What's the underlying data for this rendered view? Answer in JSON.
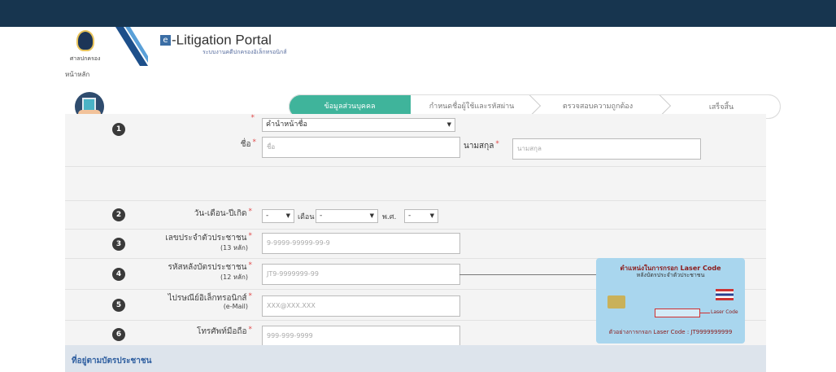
{
  "header": {
    "logo_text": "ศาลปกครอง",
    "title": "-Litigation Portal",
    "title_prefix": "e",
    "subtitle": "ระบบงานคดีปกครองอิเล็กทรอนิกส์"
  },
  "breadcrumb": "หน้าหลัก",
  "steps": [
    {
      "label": "ข้อมูลส่วนบุคคล",
      "active": true
    },
    {
      "label": "กำหนดชื่อผู้ใช้และรหัสผ่าน",
      "active": false
    },
    {
      "label": "ตรวจสอบความถูกต้อง",
      "active": false
    },
    {
      "label": "เสร็จสิ้น",
      "active": false
    }
  ],
  "form": {
    "row1": {
      "number": "1",
      "name_label": "ชื่อ",
      "title_select": "คำนำหน้าชื่อ",
      "firstname_placeholder": "ชื่อ",
      "lastname_label": "นามสกุล",
      "lastname_placeholder": "นามสกุล"
    },
    "row2": {
      "number": "2",
      "label": "วัน-เดือน-ปีเกิด",
      "day_value": "-",
      "month_label": "เดือน",
      "month_value": "-",
      "year_label": "พ.ศ.",
      "year_value": "-"
    },
    "row3": {
      "number": "3",
      "label": "เลขประจำตัวประชาชน",
      "sub": "(13 หลัก)",
      "placeholder": "9-9999-99999-99-9"
    },
    "row4": {
      "number": "4",
      "label": "รหัสหลังบัตรประชาชน",
      "sub": "(12 หลัก)",
      "placeholder": "JT9-9999999-99"
    },
    "row5": {
      "number": "5",
      "label": "ไปรษณีย์อิเล็กทรอนิกส์",
      "sub": "(e-Mail)",
      "placeholder": "XXX@XXX.XXX"
    },
    "row6": {
      "number": "6",
      "label": "โทรศัพท์มือถือ",
      "placeholder": "999-999-9999"
    }
  },
  "laser_card": {
    "title": "ตำแหน่งในการกรอก Laser Code",
    "subtitle": "หลังบัตรประจำตัวประชาชน",
    "laser_label": "Laser Code",
    "example": "ตัวอย่างการกรอก Laser Code : JT9999999999"
  },
  "section_next": "ที่อยู่ตามบัตรประชาชน",
  "colors": {
    "topbar": "#17354f",
    "active_step": "#3fb49b",
    "required": "#e04a4a"
  }
}
